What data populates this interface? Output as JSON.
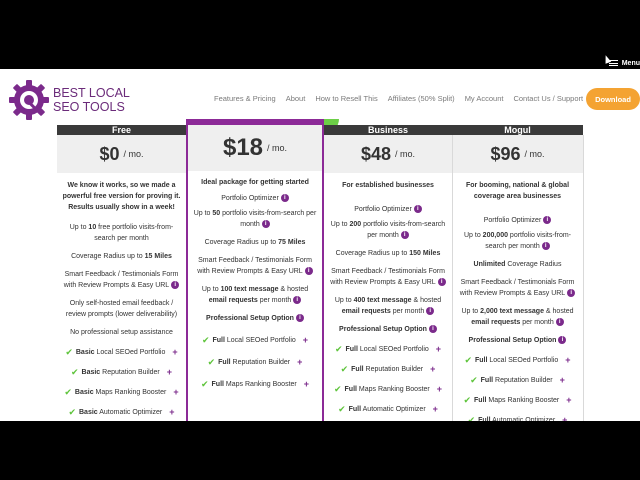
{
  "top_bar": {
    "menu_label": "Menu"
  },
  "brand": {
    "line1": "BEST LOCAL",
    "line2": "SEO TOOLS"
  },
  "nav": {
    "items": [
      "Features & Pricing",
      "About",
      "How to Resell This",
      "Affiliates (50% Split)",
      "My Account",
      "Contact Us / Support"
    ],
    "download_label": "Download"
  },
  "colors": {
    "brand_purple": "#7b2a8b",
    "accent_orange": "#f4a332",
    "check_green": "#5ec43b"
  },
  "plans": [
    {
      "name": "Free",
      "price": "$0",
      "per": "/ mo.",
      "desc": "We know it works, so we made a powerful free version for proving it. Results usually show in a week!",
      "portfolio_prefix": "Up to ",
      "portfolio_num": "10",
      "portfolio_suffix": " free portfolio visits-from-search per month",
      "radius_prefix": "Coverage Radius up to ",
      "radius_val": "15 Miles",
      "smart": "Smart Feedback / Testimonials Form with Review Prompts & Easy URL",
      "sms": "Only self-hosted email feedback / review prompts (lower deliverability)",
      "setup": "No professional setup assistance",
      "features": [
        {
          "level": "Basic",
          "text": " Local SEOed Portfolio"
        },
        {
          "level": "Basic",
          "text": " Reputation Builder"
        },
        {
          "level": "Basic",
          "text": " Maps Ranking Booster"
        },
        {
          "level": "Basic",
          "text": " Automatic Optimizer"
        }
      ]
    },
    {
      "name": "",
      "price": "$18",
      "per": "/ mo.",
      "desc": "Ideal package for getting started",
      "optimizer": "Portfolio Optimizer",
      "portfolio_prefix": "Up to ",
      "portfolio_num": "50",
      "portfolio_suffix": " portfolio visits-from-search per month",
      "radius_prefix": "Coverage Radius up to ",
      "radius_val": "75 Miles",
      "smart": "Smart Feedback / Testimonials Form with Review Prompts & Easy URL",
      "sms_prefix": "Up to ",
      "sms_num": "100 text message",
      "sms_mid": " & hosted ",
      "sms_bold": "email requests",
      "sms_suffix": " per month",
      "setup": "Professional Setup Option",
      "features": [
        {
          "level": "Full",
          "text": " Local SEOed Portfolio"
        },
        {
          "level": "Full",
          "text": " Reputation Builder"
        },
        {
          "level": "Full",
          "text": " Maps Ranking Booster"
        }
      ]
    },
    {
      "name": "Business",
      "price": "$48",
      "per": "/ mo.",
      "desc": "For established businesses",
      "optimizer": "Portfolio Optimizer",
      "portfolio_prefix": "Up to ",
      "portfolio_num": "200",
      "portfolio_suffix": " portfolio visits-from-search per month",
      "radius_prefix": "Coverage Radius up to ",
      "radius_val": "150 Miles",
      "smart": "Smart Feedback / Testimonials Form with Review Prompts & Easy URL",
      "sms_prefix": "Up to ",
      "sms_num": "400 text message",
      "sms_mid": " & hosted ",
      "sms_bold": "email requests",
      "sms_suffix": " per month",
      "setup": "Professional Setup Option",
      "features": [
        {
          "level": "Full",
          "text": " Local SEOed Portfolio"
        },
        {
          "level": "Full",
          "text": " Reputation Builder"
        },
        {
          "level": "Full",
          "text": " Maps Ranking Booster"
        },
        {
          "level": "Full",
          "text": " Automatic Optimizer"
        }
      ]
    },
    {
      "name": "Mogul",
      "price": "$96",
      "per": "/ mo.",
      "desc": "For booming, national & global coverage area businesses",
      "optimizer": "Portfolio Optimizer",
      "portfolio_prefix": "Up to ",
      "portfolio_num": "200,000",
      "portfolio_suffix": " portfolio visits-from-search per month",
      "radius_prefix": "",
      "radius_val": "Unlimited",
      "radius_suffix": " Coverage Radius",
      "smart": "Smart Feedback / Testimonials Form with Review Prompts & Easy URL",
      "sms_prefix": "Up to ",
      "sms_num": "2,000 text message",
      "sms_mid": " & hosted ",
      "sms_bold": "email requests",
      "sms_suffix": " per month",
      "setup": "Professional Setup Option",
      "features": [
        {
          "level": "Full",
          "text": " Local SEOed Portfolio"
        },
        {
          "level": "Full",
          "text": " Reputation Builder"
        },
        {
          "level": "Full",
          "text": " Maps Ranking Booster"
        },
        {
          "level": "Full",
          "text": " Automatic Optimizer"
        }
      ]
    }
  ]
}
